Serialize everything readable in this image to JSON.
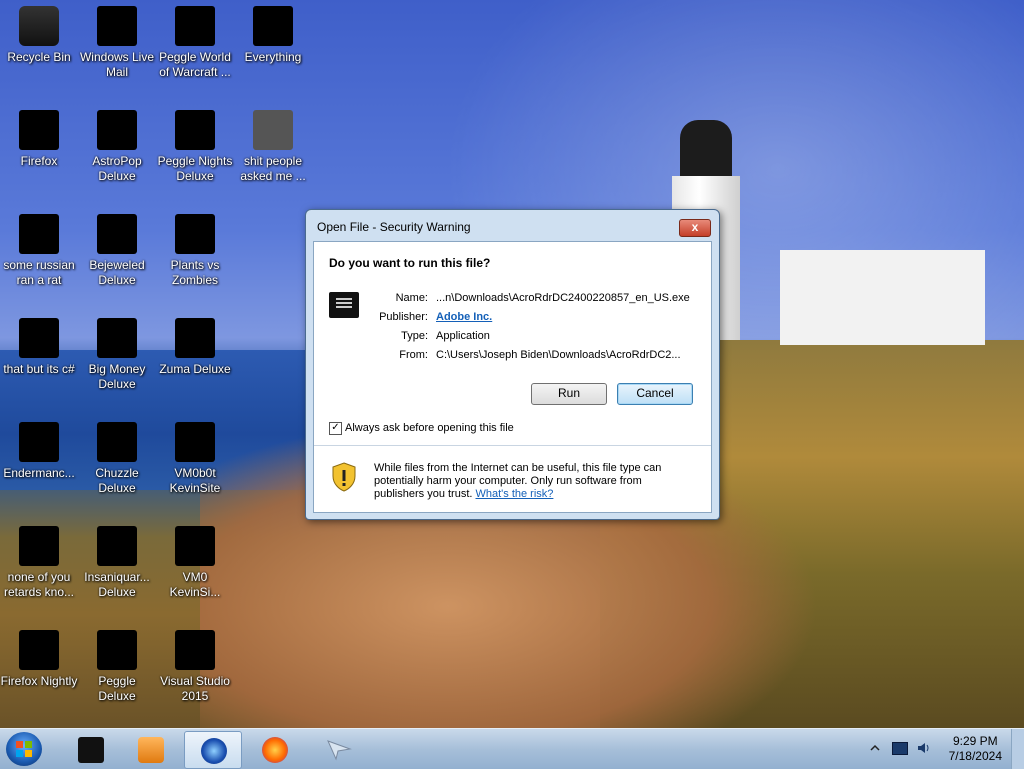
{
  "desktop": {
    "icons": [
      {
        "label": "Recycle Bin"
      },
      {
        "label": "Windows Live Mail"
      },
      {
        "label": "Peggle World of Warcraft ..."
      },
      {
        "label": "Everything"
      },
      {
        "label": "Firefox"
      },
      {
        "label": "AstroPop Deluxe"
      },
      {
        "label": "Peggle Nights Deluxe"
      },
      {
        "label": "shit people asked me ..."
      },
      {
        "label": "some russian ran a rat"
      },
      {
        "label": "Bejeweled Deluxe"
      },
      {
        "label": "Plants vs Zombies"
      },
      {
        "label": "that but its c#"
      },
      {
        "label": "Big Money Deluxe"
      },
      {
        "label": "Zuma Deluxe"
      },
      {
        "label": "Endermanc..."
      },
      {
        "label": "Chuzzle Deluxe"
      },
      {
        "label": "VM0b0t KevinSite"
      },
      {
        "label": "none of you retards kno..."
      },
      {
        "label": "Insaniquar... Deluxe"
      },
      {
        "label": "VM0 KevinSi..."
      },
      {
        "label": "Firefox Nightly"
      },
      {
        "label": "Peggle Deluxe"
      },
      {
        "label": "Visual Studio 2015"
      }
    ]
  },
  "dialog": {
    "title": "Open File - Security Warning",
    "close_label": "x",
    "question": "Do you want to run this file?",
    "name_label": "Name:",
    "name_value": "...n\\Downloads\\AcroRdrDC2400220857_en_US.exe",
    "publisher_label": "Publisher:",
    "publisher_value": "Adobe Inc.",
    "type_label": "Type:",
    "type_value": "Application",
    "from_label": "From:",
    "from_value": "C:\\Users\\Joseph Biden\\Downloads\\AcroRdrDC2...",
    "run_label": "Run",
    "cancel_label": "Cancel",
    "checkbox_checked": true,
    "checkbox_label": "Always ask before opening this file",
    "warning_text": "While files from the Internet can be useful, this file type can potentially harm your computer. Only run software from publishers you trust.",
    "risk_link": "What's the risk?"
  },
  "taskbar": {
    "time": "9:29 PM",
    "date": "7/18/2024"
  }
}
